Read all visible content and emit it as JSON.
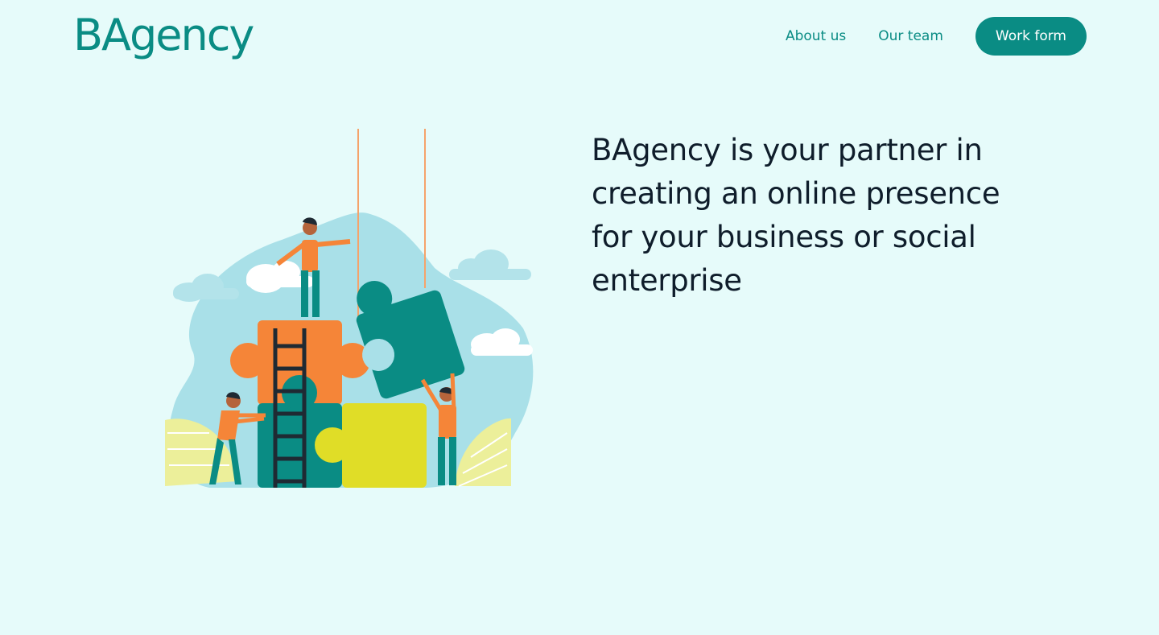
{
  "brand": {
    "name": "BAgency"
  },
  "nav": {
    "items": [
      {
        "label": "About us"
      },
      {
        "label": "Our team"
      }
    ],
    "cta_label": "Work form"
  },
  "hero": {
    "headline": "BAgency is your partner in creating an online presence for your business or social enterprise",
    "illustration": "teamwork-puzzle-illustration"
  },
  "colors": {
    "background": "#e6fbfa",
    "brand_teal": "#0a8c84",
    "text_dark": "#0f1d2b",
    "puzzle_orange": "#f58538",
    "puzzle_yellow": "#e0dd27",
    "blob_blue": "#a9e0e8",
    "leaf_yellow": "#ecef9a"
  }
}
